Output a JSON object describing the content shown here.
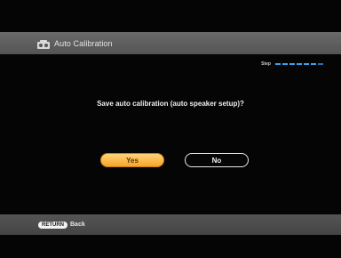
{
  "header": {
    "title": "Auto Calibration",
    "icon": "speaker-setup-icon"
  },
  "progress": {
    "label": "Step",
    "total_steps": 7,
    "completed_steps": 6
  },
  "dialog": {
    "question": "Save auto calibration (auto speaker setup)?",
    "yes_label": "Yes",
    "no_label": "No",
    "selected": "Yes"
  },
  "footer": {
    "key_label": "RETURN",
    "action_label": "Back"
  },
  "colors": {
    "accent": "#f6a628",
    "step_active": "#3aa0ee",
    "background": "#050505",
    "bar": "#5a5a5a"
  }
}
